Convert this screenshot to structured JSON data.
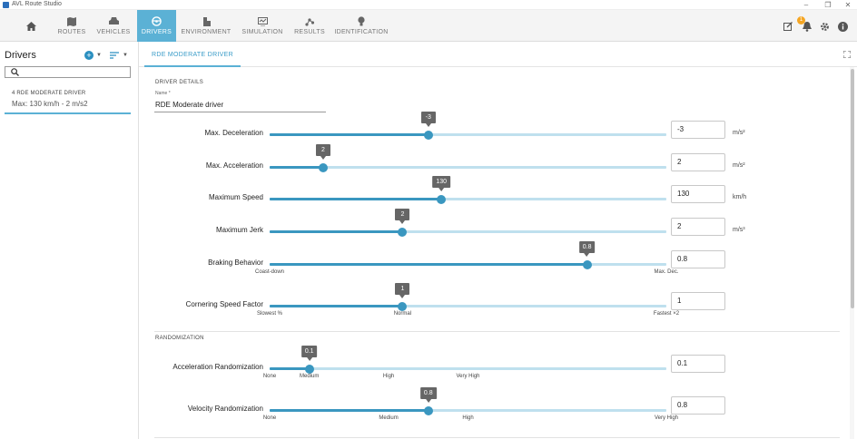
{
  "window": {
    "title": "AVL Route Studio"
  },
  "nav": {
    "items": [
      {
        "key": "routes",
        "label": "ROUTES"
      },
      {
        "key": "vehicles",
        "label": "VEHICLES"
      },
      {
        "key": "drivers",
        "label": "DRIVERS"
      },
      {
        "key": "environment",
        "label": "ENVIRONMENT"
      },
      {
        "key": "simulation",
        "label": "SIMULATION"
      },
      {
        "key": "results",
        "label": "RESULTS"
      },
      {
        "key": "identification",
        "label": "IDENTIFICATION"
      }
    ],
    "active": "drivers",
    "notification_count": "1",
    "accent_color": "#5bb1d5"
  },
  "sidebar": {
    "title": "Drivers",
    "search": {
      "value": "",
      "placeholder": ""
    },
    "items": [
      {
        "title": "4 RDE MODERATE DRIVER",
        "subtitle": "Max: 130 km/h - 2 m/s2"
      }
    ]
  },
  "main": {
    "tab_label": "RDE MODERATE DRIVER",
    "details_section": "DRIVER DETAILS",
    "name_label": "Name *",
    "name_value": "RDE Moderate driver",
    "randomization_section": "RANDOMIZATION",
    "sliders": [
      {
        "key": "max_deceleration",
        "label": "Max. Deceleration",
        "tooltip": "-3",
        "value": "-3",
        "unit": "m/s²",
        "level": 0.4,
        "ticks": []
      },
      {
        "key": "max_acceleration",
        "label": "Max. Acceleration",
        "tooltip": "2",
        "value": "2",
        "unit": "m/s²",
        "level": 0.135,
        "ticks": []
      },
      {
        "key": "maximum_speed",
        "label": "Maximum Speed",
        "tooltip": "130",
        "value": "130",
        "unit": "km/h",
        "level": 0.433,
        "ticks": []
      },
      {
        "key": "maximum_jerk",
        "label": "Maximum Jerk",
        "tooltip": "2",
        "value": "2",
        "unit": "m/s³",
        "level": 0.335,
        "ticks": []
      },
      {
        "key": "braking_behavior",
        "label": "Braking Behavior",
        "tooltip": "0.8",
        "value": "0.8",
        "unit": "",
        "level": 0.8,
        "ticks": [
          {
            "text": "Coast-down",
            "pos": 0.0
          },
          {
            "text": "Max. Dec.",
            "pos": 1.0
          }
        ]
      },
      {
        "key": "cornering_speed_factor",
        "label": "Cornering Speed Factor",
        "tooltip": "1",
        "value": "1",
        "unit": "",
        "level": 0.335,
        "ticks": [
          {
            "text": "Slowest %",
            "pos": 0.0
          },
          {
            "text": "Normal",
            "pos": 0.335
          },
          {
            "text": "Fastest ×2",
            "pos": 1.0
          }
        ]
      },
      {
        "key": "acceleration_randomization",
        "label": "Acceleration Randomization",
        "tooltip": "0.1",
        "value": "0.1",
        "unit": "",
        "level": 0.1,
        "ticks": [
          {
            "text": "None",
            "pos": 0.0
          },
          {
            "text": "Medium",
            "pos": 0.1
          },
          {
            "text": "High",
            "pos": 0.3
          },
          {
            "text": "Very High",
            "pos": 0.5
          }
        ]
      },
      {
        "key": "velocity_randomization",
        "label": "Velocity Randomization",
        "tooltip": "0.8",
        "value": "0.8",
        "unit": "",
        "level": 0.4,
        "ticks": [
          {
            "text": "None",
            "pos": 0.0
          },
          {
            "text": "Medium",
            "pos": 0.3
          },
          {
            "text": "High",
            "pos": 0.5
          },
          {
            "text": "Very High",
            "pos": 1.0
          }
        ]
      }
    ]
  }
}
